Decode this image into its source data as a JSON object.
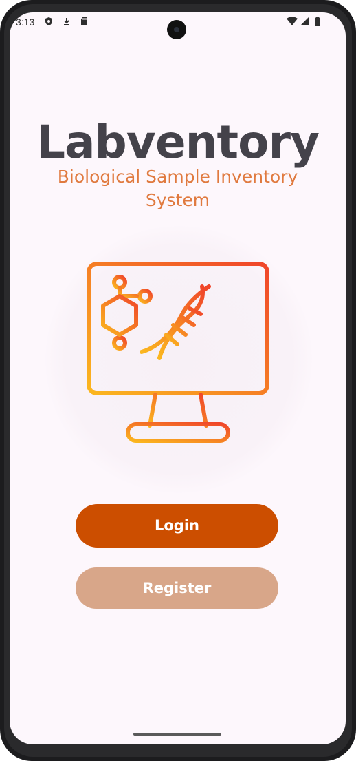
{
  "status_bar": {
    "time": "3:13",
    "left_icons": [
      "shield-icon",
      "download-icon",
      "sd-card-icon"
    ],
    "right_icons": [
      "wifi-icon",
      "signal-icon",
      "battery-icon"
    ]
  },
  "app": {
    "title": "Labventory",
    "subtitle": "Biological Sample Inventory System",
    "hero_icon": "monitor-dna-molecule-icon"
  },
  "buttons": {
    "login_label": "Login",
    "register_label": "Register"
  },
  "colors": {
    "background": "#fdf7fc",
    "title": "#44424a",
    "subtitle": "#e07a3f",
    "login": "#cc4e00",
    "register": "#d8a689",
    "gradient_start": "#fbb71f",
    "gradient_end": "#f0452a"
  }
}
